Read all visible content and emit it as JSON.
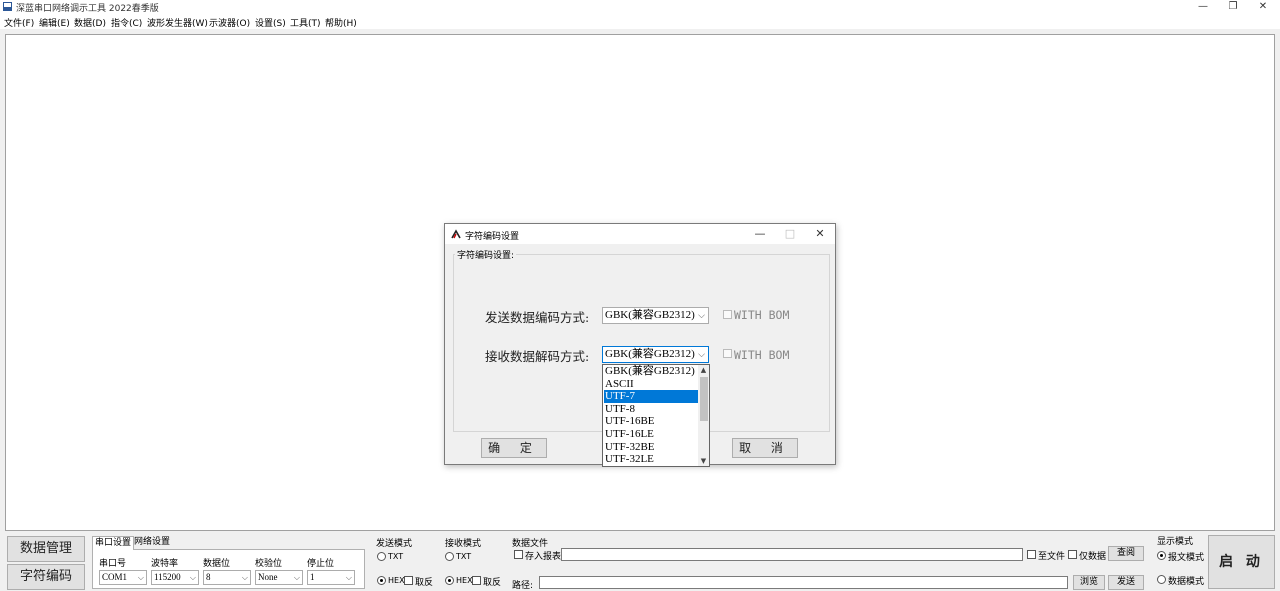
{
  "window": {
    "title": "深蓝串口网络调示工具 2022春季版",
    "minimize": "—",
    "maximize": "❐",
    "close": "✕"
  },
  "menu": [
    "文件(F)",
    "编辑(E)",
    "数据(D)",
    "指令(C)",
    "波形发生器(W)",
    "示波器(O)",
    "设置(S)",
    "工具(T)",
    "帮助(H)"
  ],
  "dialog": {
    "title": "字符编码设置",
    "minimize": "—",
    "maximize": "□",
    "close": "✕",
    "group_label": "字符编码设置:",
    "send_label": "发送数据编码方式:",
    "send_value": "GBK(兼容GB2312)",
    "send_bom_label": "WITH BOM",
    "recv_label": "接收数据解码方式:",
    "recv_value": "GBK(兼容GB2312)",
    "recv_bom_label": "WITH BOM",
    "ok_label": "确 定",
    "cancel_label": "取 消",
    "options": [
      "GBK(兼容GB2312)",
      "ASCII",
      "UTF-7",
      "UTF-8",
      "UTF-16BE",
      "UTF-16LE",
      "UTF-32BE",
      "UTF-32LE"
    ],
    "selected_option": "UTF-7"
  },
  "bottom": {
    "data_mgmt": "数据管理",
    "char_encoding": "字符编码",
    "tab_serial": "串口设置",
    "tab_network": "网络设置",
    "port_label": "串口号",
    "baud_label": "波特率",
    "databits_label": "数据位",
    "parity_label": "校验位",
    "stopbits_label": "停止位",
    "port_value": "COM1",
    "baud_value": "115200",
    "databits_value": "8",
    "parity_value": "None",
    "stopbits_value": "1",
    "send_mode_label": "发送模式",
    "send_txt": "TXT",
    "send_hex": "HEX",
    "send_invert": "取反",
    "recv_mode_label": "接收模式",
    "recv_txt": "TXT",
    "recv_hex": "HEX",
    "recv_invert": "取反",
    "data_file_label": "数据文件",
    "save_report": "存入报表",
    "to_file": "至文件",
    "only_data": "仅数据",
    "query_button": "查阅",
    "path_label": "路径:",
    "browse_button": "浏览",
    "send_button": "发送",
    "display_mode_label": "显示模式",
    "report_mode": "报文模式",
    "data_mode": "数据模式",
    "start_button": "启 动"
  }
}
